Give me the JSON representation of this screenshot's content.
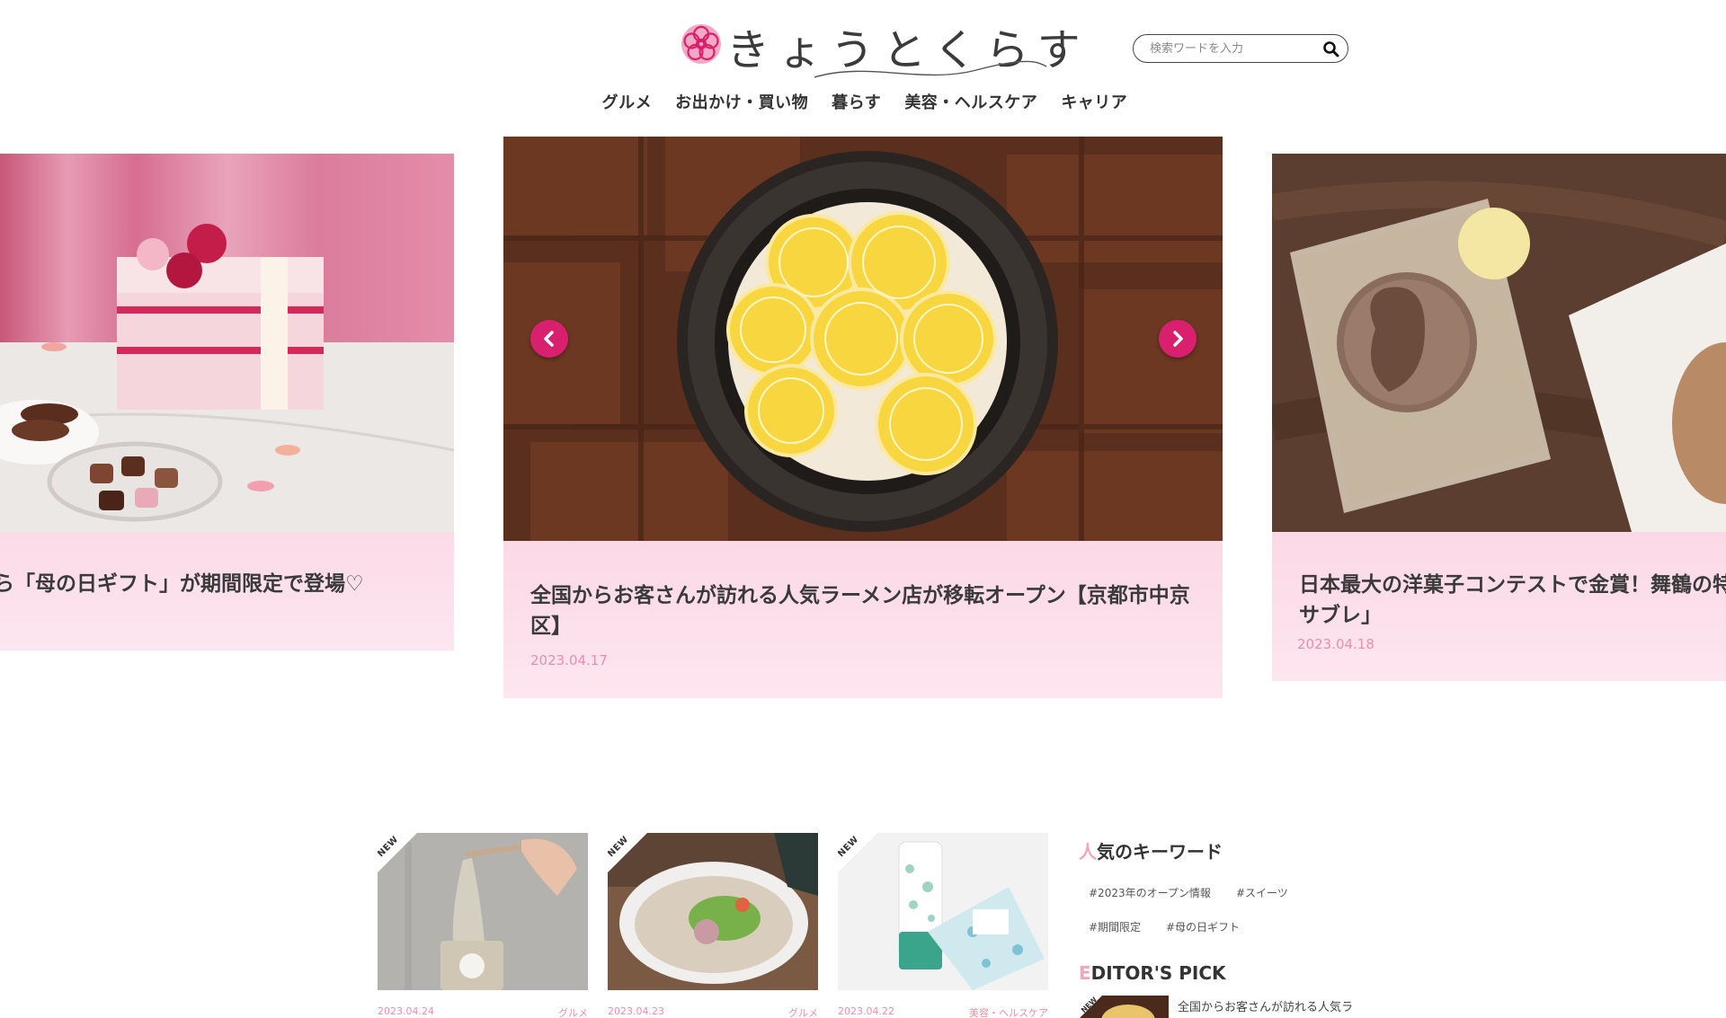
{
  "site": {
    "logo_text": "きょうとくらす",
    "logo_alt": "logo-flower-icon"
  },
  "search": {
    "placeholder": "検索ワードを入力",
    "icon": "search-icon"
  },
  "nav": {
    "items": [
      {
        "label": "グルメ"
      },
      {
        "label": "お出かけ・買い物"
      },
      {
        "label": "暮らす"
      },
      {
        "label": "美容・ヘルスケア"
      },
      {
        "label": "キャリア"
      }
    ]
  },
  "carousel": {
    "left": {
      "title": "から「母の日ギフト」が期間限定で登場♡"
    },
    "center": {
      "title": "全国からお客さんが訪れる人気ラーメン店が移転オープン【京都市中京区】",
      "date": "2023.04.17"
    },
    "right": {
      "title_line1": "日本最大の洋菓子コンテストで金賞！舞鶴の特産",
      "title_line2": "サブレ」",
      "date": "2023.04.18"
    },
    "prev_icon": "chevron-left-icon",
    "next_icon": "chevron-right-icon"
  },
  "articles": [
    {
      "badge": "NEW",
      "date": "2023.04.24",
      "category": "グルメ"
    },
    {
      "badge": "NEW",
      "date": "2023.04.23",
      "category": "グルメ"
    },
    {
      "badge": "NEW",
      "date": "2023.04.22",
      "category": "美容・ヘルスケア"
    }
  ],
  "sidebar": {
    "keywords_heading_first": "人",
    "keywords_heading_rest": "気のキーワード",
    "keywords": [
      "#2023年のオープン情報",
      "#スイーツ",
      "#期間限定",
      "#母の日ギフト"
    ],
    "editors_heading_first": "E",
    "editors_heading_rest": "DITOR'S PICK",
    "pick_badge": "NEW",
    "pick_text": "全国からお客さんが訪れる人気ラ"
  },
  "colors": {
    "accent": "#d8206f",
    "card_pink": "#f7b6cf",
    "date_pink": "#e590ae"
  }
}
